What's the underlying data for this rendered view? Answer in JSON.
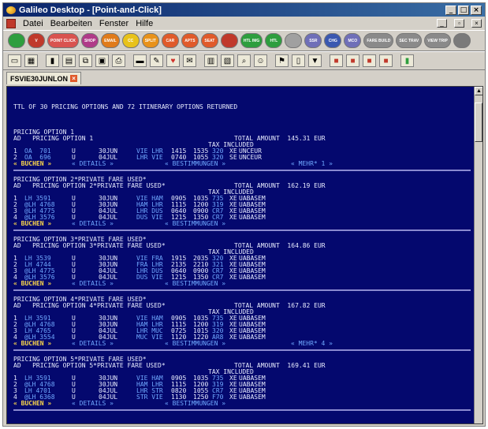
{
  "window": {
    "title": "Galileo Desktop - [Point-and-Click]",
    "controls": [
      "_",
      "□",
      "×"
    ]
  },
  "menu": {
    "items": [
      "Datei",
      "Bearbeiten",
      "Fenster",
      "Hilfe"
    ],
    "mdi_controls": [
      "_",
      "▫",
      "×"
    ]
  },
  "toolbar1": {
    "buttons": [
      {
        "label": "",
        "color": "#2e9e3e",
        "icon": "globe-icon"
      },
      {
        "label": "V",
        "color": "#c0392b",
        "icon": "v-icon"
      },
      {
        "label": "POINT CLICK",
        "color": "#d9534f"
      },
      {
        "label": "SHOP",
        "color": "#b03a88"
      },
      {
        "label": "EMAIL",
        "color": "#e07b1a"
      },
      {
        "label": "CC",
        "color": "#e8c21a"
      },
      {
        "label": "SPLIT",
        "color": "#e8921a"
      },
      {
        "label": "CAR",
        "color": "#e05a2a"
      },
      {
        "label": "APTS",
        "color": "#e05a2a"
      },
      {
        "label": "SEAT",
        "color": "#e05a2a"
      },
      {
        "label": "",
        "color": "#c0392b",
        "icon": "stop-icon"
      },
      {
        "label": "HTL IMG",
        "color": "#2e9e3e"
      },
      {
        "label": "HTL",
        "color": "#2e9e3e"
      },
      {
        "label": "",
        "color": "#a0a0a0",
        "icon": "wave-icon"
      },
      {
        "label": "SSR",
        "color": "#6f6fb8"
      },
      {
        "label": "CHG",
        "color": "#3a58b0"
      },
      {
        "label": "MCO",
        "color": "#6f6fb8"
      },
      {
        "label": "FARE BUILD",
        "color": "#8a8a8a"
      },
      {
        "label": "SEC TRAV",
        "color": "#8a8a8a"
      },
      {
        "label": "VIEW TRIP",
        "color": "#8a8a8a"
      },
      {
        "label": "",
        "color": "#7a7a7a",
        "icon": "globe-icon"
      }
    ]
  },
  "toolbar2": {
    "icons": [
      "terminal-icon",
      "grid-icon",
      "book-icon",
      "card-icon",
      "copy-icon",
      "paste-icon",
      "print-icon",
      "queue-icon",
      "pencil-icon",
      "heart-icon",
      "mail-icon",
      "report-icon",
      "calc-icon",
      "search-icon",
      "user-icon",
      "flag-icon",
      "doc-icon",
      "filter-icon",
      "red-a-icon",
      "red-b-icon",
      "red-c-icon",
      "red-d-icon",
      "green-icon"
    ]
  },
  "tab": {
    "label": "FSVIE30JUNLON",
    "close": "×"
  },
  "terminal": {
    "title_line": "TTL OF 30 PRICING OPTIONS AND 72 ITINERARY OPTIONS RETURNED",
    "options": [
      {
        "header1": "PRICING OPTION 1",
        "header2": "AD   PRICING OPTION 1",
        "total": "TOTAL AMOUNT  145.31 EUR",
        "tax": "TAX INCLUDED",
        "segments": [
          {
            "n": "1",
            "flight": "OA  701",
            "cls": "U",
            "date": "30JUN",
            "route": "VIE LHR",
            "dep": "1415",
            "arr": "1535",
            "fare": "320",
            "code": "XE",
            "basis": "UNCEUR"
          },
          {
            "n": "2",
            "flight": "OA  696",
            "cls": "U",
            "date": "04JUL",
            "route": "LHR VIE",
            "dep": "0740",
            "arr": "1055",
            "fare": "320",
            "code": "SE",
            "basis": "UNCEUR"
          }
        ],
        "actions": [
          "« BUCHEN »",
          "« DETAILS »",
          "« BESTIMMUNGEN »",
          "« MEHR* 1 »"
        ]
      },
      {
        "header1": "PRICING OPTION 2*PRIVATE FARE USED*",
        "header2": "AD   PRICING OPTION 2*PRIVATE FARE USED*",
        "total": "TOTAL AMOUNT  162.19 EUR",
        "tax": "TAX INCLUDED",
        "segments": [
          {
            "n": "1",
            "flight": "LH 3591",
            "cls": "U",
            "date": "30JUN",
            "route": "VIE HAM",
            "dep": "0905",
            "arr": "1035",
            "fare": "735",
            "code": "XE",
            "basis": "UABASEM"
          },
          {
            "n": "2",
            "flight": "@LH 4768",
            "cls": "U",
            "date": "30JUN",
            "route": "HAM LHR",
            "dep": "1115",
            "arr": "1200",
            "fare": "319",
            "code": "XE",
            "basis": "UABASEM"
          },
          {
            "n": "3",
            "flight": "@LH 4775",
            "cls": "U",
            "date": "04JUL",
            "route": "LHR DUS",
            "dep": "0640",
            "arr": "0900",
            "fare": "CR7",
            "code": "XE",
            "basis": "UABASEM"
          },
          {
            "n": "4",
            "flight": "@LH 3576",
            "cls": "U",
            "date": "04JUL",
            "route": "DUS VIE",
            "dep": "1215",
            "arr": "1350",
            "fare": "CR7",
            "code": "XE",
            "basis": "UABASEM"
          }
        ],
        "actions": [
          "« BUCHEN »",
          "« DETAILS »",
          "« BESTIMMUNGEN »",
          ""
        ]
      },
      {
        "header1": "PRICING OPTION 3*PRIVATE FARE USED*",
        "header2": "AD   PRICING OPTION 3*PRIVATE FARE USED*",
        "total": "TOTAL AMOUNT  164.86 EUR",
        "tax": "TAX INCLUDED",
        "segments": [
          {
            "n": "1",
            "flight": "LH 3539",
            "cls": "U",
            "date": "30JUN",
            "route": "VIE FRA",
            "dep": "1915",
            "arr": "2035",
            "fare": "320",
            "code": "XE",
            "basis": "UABASEM"
          },
          {
            "n": "2",
            "flight": "LH 4744",
            "cls": "U",
            "date": "30JUN",
            "route": "FRA LHR",
            "dep": "2135",
            "arr": "2210",
            "fare": "321",
            "code": "XE",
            "basis": "UABASEM"
          },
          {
            "n": "3",
            "flight": "@LH 4775",
            "cls": "U",
            "date": "04JUL",
            "route": "LHR DUS",
            "dep": "0640",
            "arr": "0900",
            "fare": "CR7",
            "code": "XE",
            "basis": "UABASEM"
          },
          {
            "n": "4",
            "flight": "@LH 3576",
            "cls": "U",
            "date": "04JUL",
            "route": "DUS VIE",
            "dep": "1215",
            "arr": "1350",
            "fare": "CR7",
            "code": "XE",
            "basis": "UABASEM"
          }
        ],
        "actions": [
          "« BUCHEN »",
          "« DETAILS »",
          "« BESTIMMUNGEN »",
          ""
        ]
      },
      {
        "header1": "PRICING OPTION 4*PRIVATE FARE USED*",
        "header2": "AD   PRICING OPTION 4*PRIVATE FARE USED*",
        "total": "TOTAL AMOUNT  167.82 EUR",
        "tax": "TAX INCLUDED",
        "segments": [
          {
            "n": "1",
            "flight": "LH 3591",
            "cls": "U",
            "date": "30JUN",
            "route": "VIE HAM",
            "dep": "0905",
            "arr": "1035",
            "fare": "735",
            "code": "XE",
            "basis": "UABASEM"
          },
          {
            "n": "2",
            "flight": "@LH 4768",
            "cls": "U",
            "date": "30JUN",
            "route": "HAM LHR",
            "dep": "1115",
            "arr": "1200",
            "fare": "319",
            "code": "XE",
            "basis": "UABASEM"
          },
          {
            "n": "3",
            "flight": "LH 4765",
            "cls": "U",
            "date": "04JUL",
            "route": "LHR MUC",
            "dep": "0725",
            "arr": "1015",
            "fare": "320",
            "code": "XE",
            "basis": "UABASEM"
          },
          {
            "n": "4",
            "flight": "@LH 3554",
            "cls": "U",
            "date": "04JUL",
            "route": "MUC VIE",
            "dep": "1120",
            "arr": "1220",
            "fare": "AR8",
            "code": "XE",
            "basis": "UABASEM"
          }
        ],
        "actions": [
          "« BUCHEN »",
          "« DETAILS »",
          "« BESTIMMUNGEN »",
          "« MEHR* 4 »"
        ]
      },
      {
        "header1": "PRICING OPTION 5*PRIVATE FARE USED*",
        "header2": "AD   PRICING OPTION 5*PRIVATE FARE USED*",
        "total": "TOTAL AMOUNT  169.41 EUR",
        "tax": "TAX INCLUDED",
        "segments": [
          {
            "n": "1",
            "flight": "LH 3591",
            "cls": "U",
            "date": "30JUN",
            "route": "VIE HAM",
            "dep": "0905",
            "arr": "1035",
            "fare": "735",
            "code": "XE",
            "basis": "UABASEM"
          },
          {
            "n": "2",
            "flight": "@LH 4768",
            "cls": "U",
            "date": "30JUN",
            "route": "HAM LHR",
            "dep": "1115",
            "arr": "1200",
            "fare": "319",
            "code": "XE",
            "basis": "UABASEM"
          },
          {
            "n": "3",
            "flight": "LH 4701",
            "cls": "U",
            "date": "04JUL",
            "route": "LHR STR",
            "dep": "0820",
            "arr": "1055",
            "fare": "CR7",
            "code": "XE",
            "basis": "UABASEM"
          },
          {
            "n": "4",
            "flight": "@LH 6368",
            "cls": "U",
            "date": "04JUL",
            "route": "STR VIE",
            "dep": "1130",
            "arr": "1250",
            "fare": "F70",
            "code": "XE",
            "basis": "UABASEM"
          }
        ],
        "actions": [
          "« BUCHEN »",
          "« DETAILS »",
          "« BESTIMMUNGEN »",
          ""
        ]
      }
    ]
  }
}
